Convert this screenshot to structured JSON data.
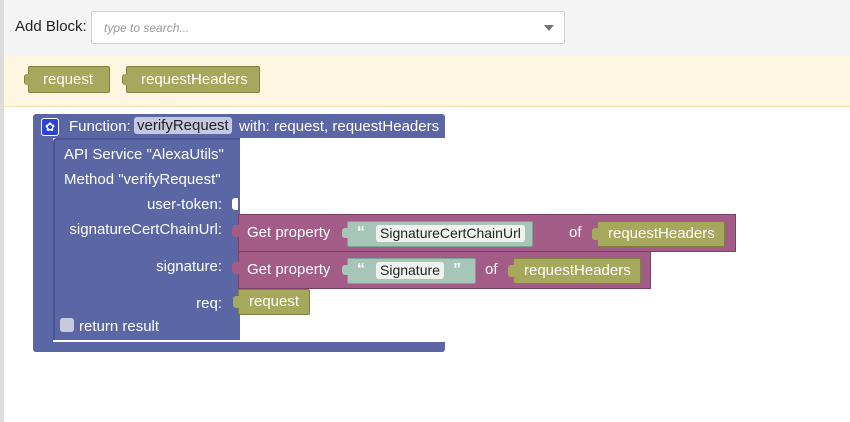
{
  "toolbar": {
    "add_block_label": "Add Block:",
    "search_placeholder": "type to search..."
  },
  "parameters": [
    "request",
    "requestHeaders"
  ],
  "function_block": {
    "keyword": "Function:",
    "name": "verifyRequest",
    "with_text": "with: request, requestHeaders"
  },
  "api_block": {
    "service": "API Service \"AlexaUtils\"",
    "method": "Method \"verifyRequest\"",
    "slots": {
      "user_token": "user-token:",
      "signature_cert_chain_url": "signatureCertChainUrl:",
      "signature": "signature:",
      "req": "req:"
    },
    "return_label": "return result"
  },
  "get_property_1": {
    "label": "Get property",
    "key": "SignatureCertChainUrl",
    "of": "of",
    "source": "requestHeaders"
  },
  "get_property_2": {
    "label": "Get property",
    "key": "Signature",
    "of": "of",
    "source": "requestHeaders"
  },
  "req_value": "request",
  "colors": {
    "function": "#5b67a5",
    "variable": "#a6a85c",
    "get_property": "#a35c88",
    "string": "#a8c6b8",
    "param_bar": "#fdf7e1"
  },
  "icons": {
    "open_quote": "“",
    "close_quote": "”",
    "gear": "✿"
  }
}
